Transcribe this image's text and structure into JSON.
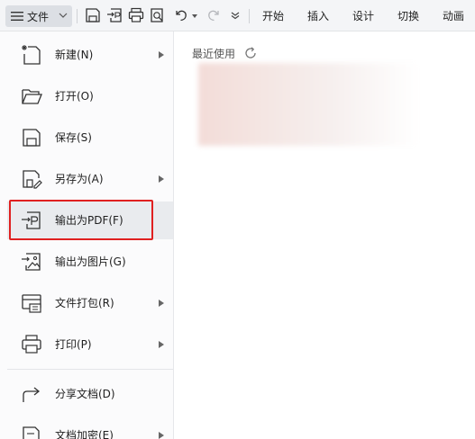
{
  "toolbar": {
    "file_label": "文件",
    "tabs": [
      "开始",
      "插入",
      "设计",
      "切换",
      "动画"
    ]
  },
  "menu": {
    "items": [
      {
        "label": "新建(N)",
        "icon": "new-document-icon",
        "has_submenu": true
      },
      {
        "label": "打开(O)",
        "icon": "folder-open-icon",
        "has_submenu": false
      },
      {
        "label": "保存(S)",
        "icon": "save-icon",
        "has_submenu": false
      },
      {
        "label": "另存为(A)",
        "icon": "save-as-icon",
        "has_submenu": true
      },
      {
        "label": "输出为PDF(F)",
        "icon": "export-pdf-icon",
        "has_submenu": false,
        "selected": true
      },
      {
        "label": "输出为图片(G)",
        "icon": "export-image-icon",
        "has_submenu": false
      },
      {
        "label": "文件打包(R)",
        "icon": "package-icon",
        "has_submenu": true
      },
      {
        "label": "打印(P)",
        "icon": "print-icon",
        "has_submenu": true
      },
      {
        "label": "分享文档(D)",
        "icon": "share-icon",
        "has_submenu": false
      },
      {
        "label": "文档加密(E)",
        "icon": "encrypt-icon",
        "has_submenu": true
      }
    ]
  },
  "content": {
    "recent_label": "最近使用"
  },
  "colors": {
    "highlight": "#e02020",
    "active_item_bg": "#e9ebee"
  }
}
